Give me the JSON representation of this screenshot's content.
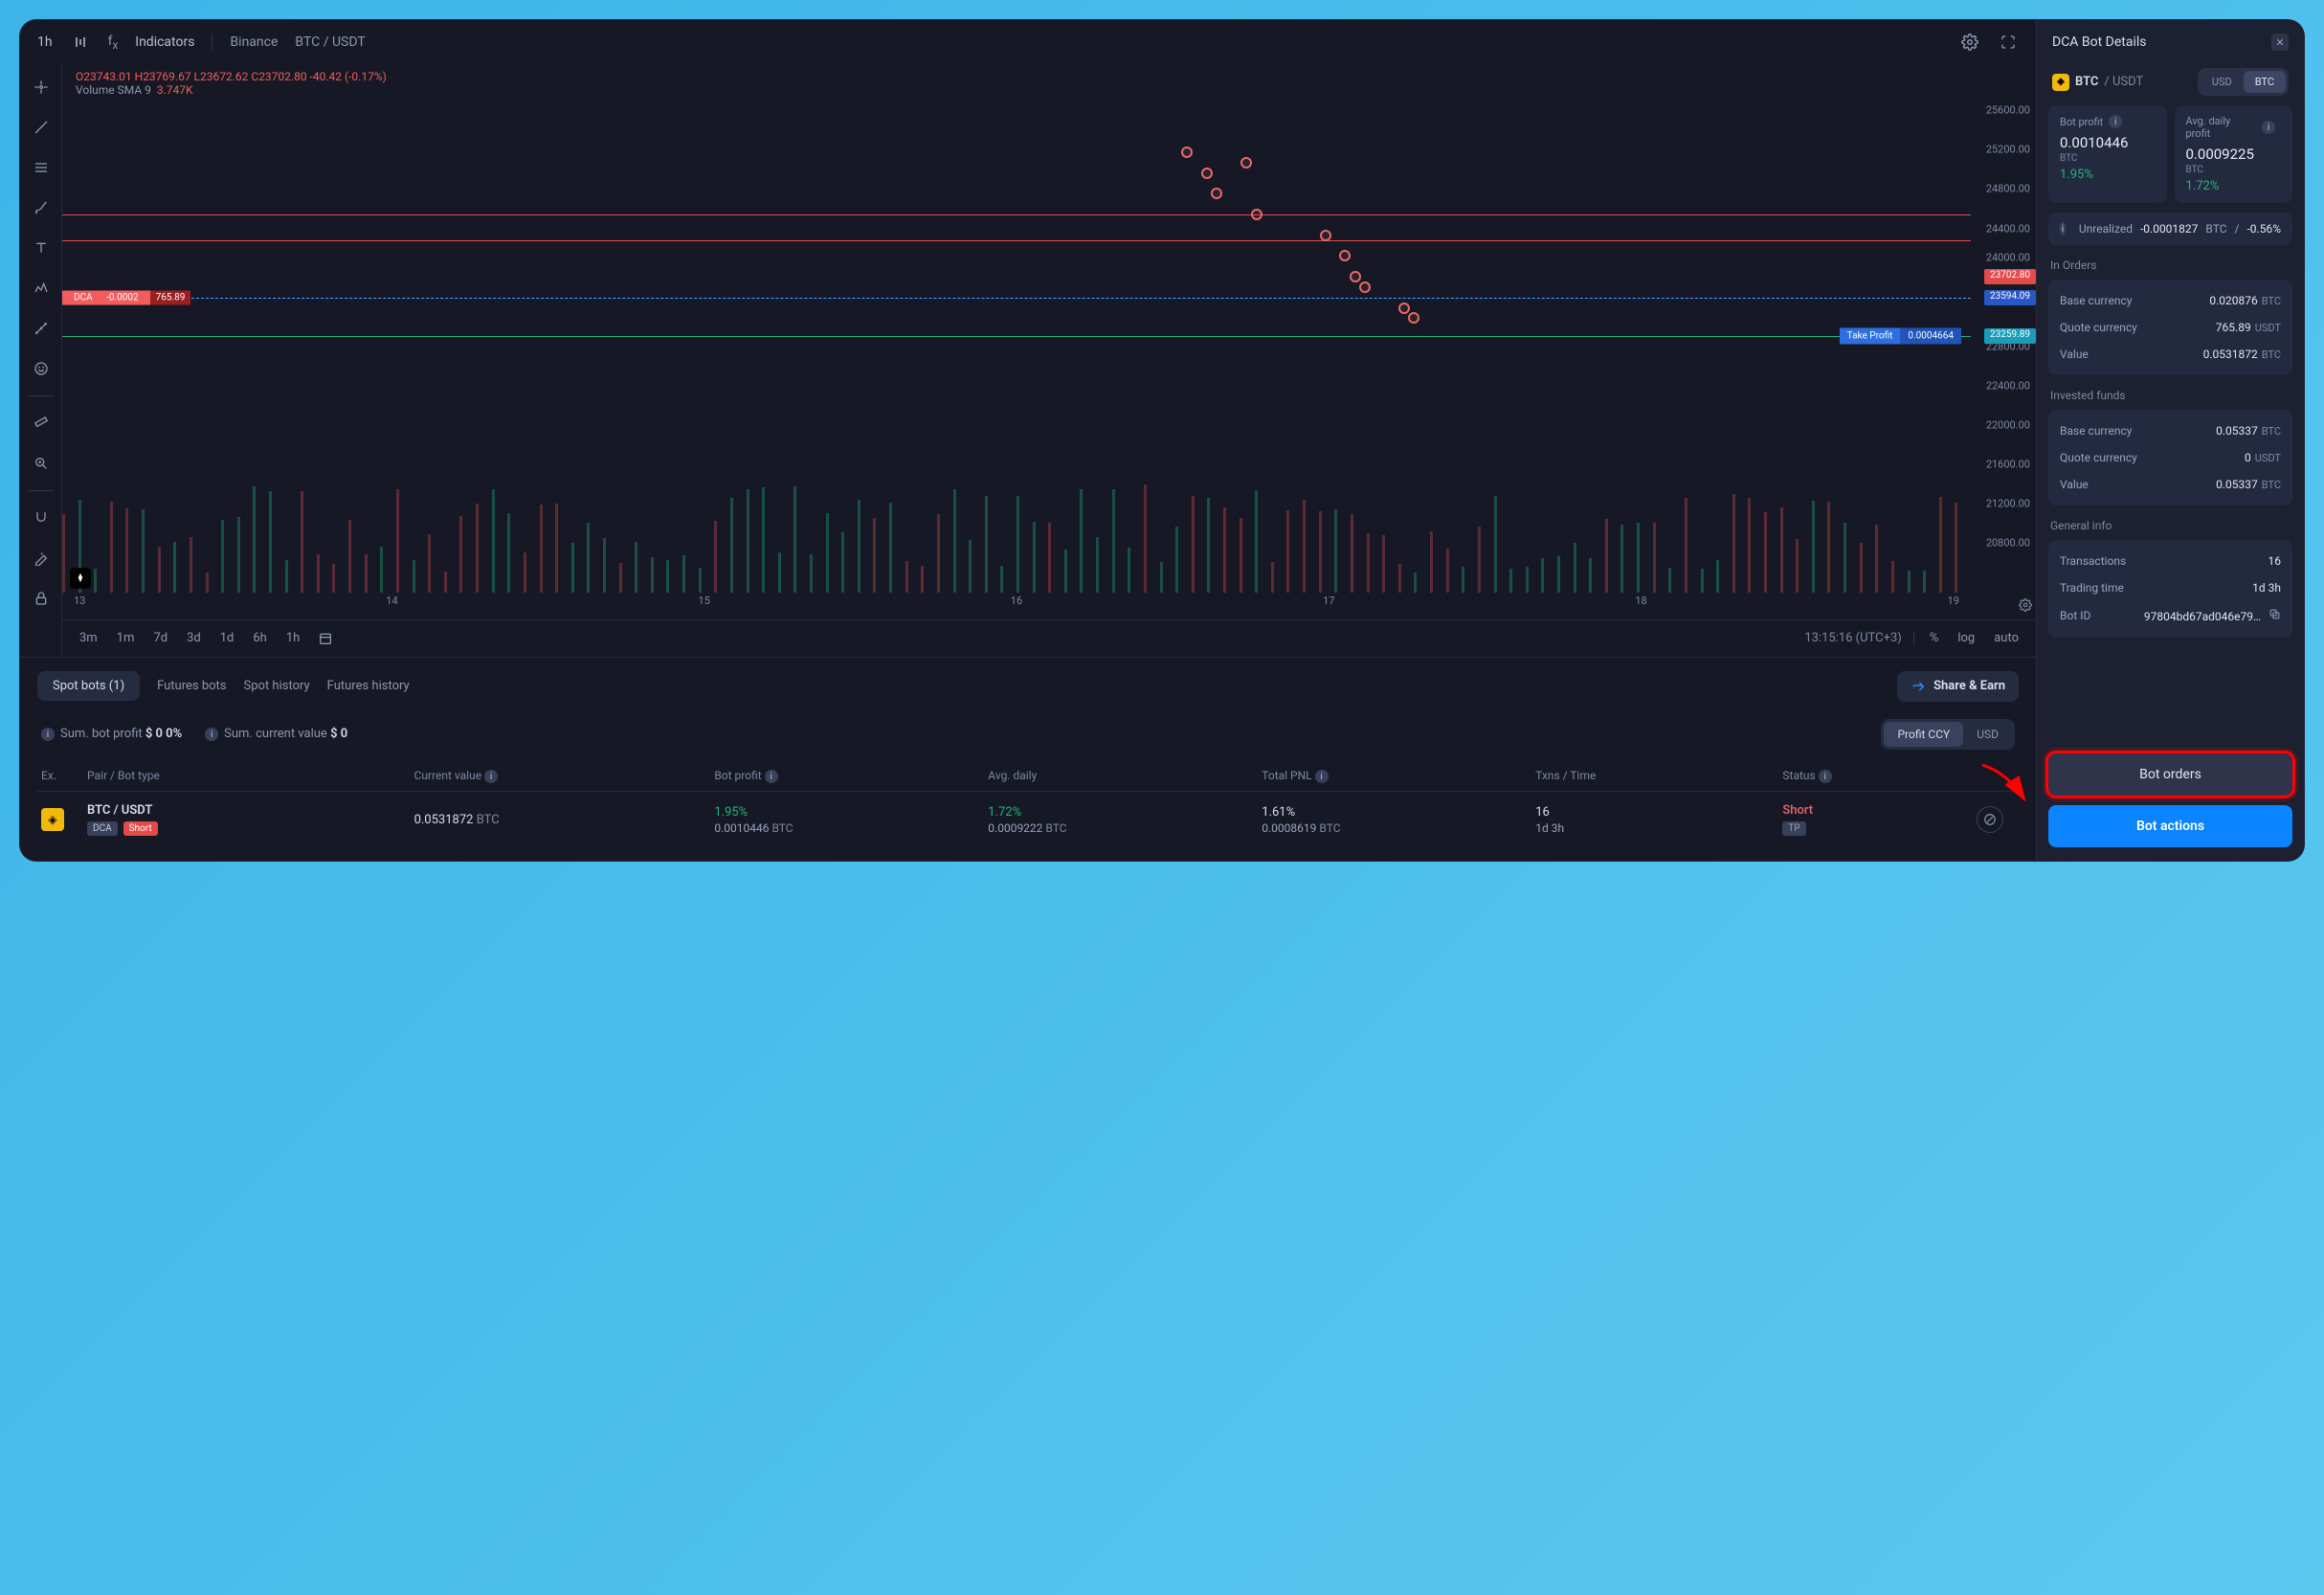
{
  "chart": {
    "timeframe": "1h",
    "indicators_label": "Indicators",
    "exchange": "Binance",
    "pair": "BTC / USDT",
    "ohlc": {
      "O": "23743.01",
      "H": "23769.67",
      "L": "23672.62",
      "C": "23702.80",
      "delta": "-40.42",
      "pct": "(-0.17%)"
    },
    "vol_sma_label": "Volume SMA 9",
    "vol_sma_value": "3.747K",
    "y_ticks": [
      "25600.00",
      "25200.00",
      "24800.00",
      "24400.00",
      "24000.00",
      "22800.00",
      "22400.00",
      "22000.00",
      "21600.00",
      "21200.00",
      "20800.00"
    ],
    "price_tags": {
      "red": "23702.80",
      "blue": "23594.09",
      "teal": "23259.89"
    },
    "dca_label": "DCA",
    "dca_val": "-0.0002",
    "dca_price": "765.89",
    "tp_label": "Take Profit",
    "tp_val": "0.0004664",
    "x_ticks": [
      "13",
      "14",
      "15",
      "16",
      "17",
      "18",
      "19"
    ],
    "bottom_tfs": [
      "3m",
      "1m",
      "7d",
      "3d",
      "1d",
      "6h",
      "1h"
    ],
    "clock": "13:15:16 (UTC+3)",
    "pct_label": "%",
    "log_label": "log",
    "auto_label": "auto"
  },
  "tabs": {
    "spot_bots": "Spot bots (1)",
    "futures_bots": "Futures bots",
    "spot_history": "Spot history",
    "futures_history": "Futures history",
    "share_earn": "Share & Earn"
  },
  "summary": {
    "bot_profit_label": "Sum. bot profit",
    "bot_profit_value": "$ 0  0%",
    "current_value_label": "Sum. current value",
    "current_value_value": "$ 0",
    "profit_ccy": "Profit CCY",
    "usd": "USD"
  },
  "columns": {
    "ex": "Ex.",
    "pair": "Pair / Bot type",
    "curval": "Current value",
    "botprofit": "Bot profit",
    "avgdaily": "Avg. daily",
    "totalpnl": "Total PNL",
    "txns": "Txns / Time",
    "status": "Status"
  },
  "row": {
    "pair": "BTC / USDT",
    "dca_badge": "DCA",
    "short_badge": "Short",
    "curval": "0.0531872",
    "curval_unit": "BTC",
    "botprofit_pct": "1.95%",
    "botprofit_val": "0.0010446",
    "botprofit_unit": "BTC",
    "avgdaily_pct": "1.72%",
    "avgdaily_val": "0.0009222",
    "avgdaily_unit": "BTC",
    "totalpnl_pct": "1.61%",
    "totalpnl_val": "0.0008619",
    "totalpnl_unit": "BTC",
    "txns": "16",
    "time": "1d 3h",
    "status": "Short",
    "status_sub": "TP"
  },
  "details": {
    "title": "DCA Bot Details",
    "pair_base": "BTC",
    "pair_sep": "/",
    "pair_quote": "USDT",
    "toggle_usd": "USD",
    "toggle_btc": "BTC",
    "bot_profit_label": "Bot profit",
    "bot_profit_val": "0.0010446",
    "bot_profit_unit": "BTC",
    "bot_profit_pct": "1.95%",
    "avg_daily_label": "Avg. daily profit",
    "avg_daily_val": "0.0009225",
    "avg_daily_unit": "BTC",
    "avg_daily_pct": "1.72%",
    "unrealized_label": "Unrealized",
    "unrealized_val": "-0.0001827",
    "unrealized_unit": "BTC",
    "unrealized_sep": "/",
    "unrealized_pct": "-0.56%",
    "in_orders_title": "In Orders",
    "io_base_label": "Base currency",
    "io_base_val": "0.020876",
    "io_base_unit": "BTC",
    "io_quote_label": "Quote currency",
    "io_quote_val": "765.89",
    "io_quote_unit": "USDT",
    "io_value_label": "Value",
    "io_value_val": "0.0531872",
    "io_value_unit": "BTC",
    "invested_title": "Invested funds",
    "if_base_label": "Base currency",
    "if_base_val": "0.05337",
    "if_base_unit": "BTC",
    "if_quote_label": "Quote currency",
    "if_quote_val": "0",
    "if_quote_unit": "USDT",
    "if_value_label": "Value",
    "if_value_val": "0.05337",
    "if_value_unit": "BTC",
    "general_title": "General info",
    "gi_txns_label": "Transactions",
    "gi_txns_val": "16",
    "gi_time_label": "Trading time",
    "gi_time_val": "1d 3h",
    "gi_botid_label": "Bot ID",
    "gi_botid_val": "97804bd67ad046e79…",
    "bot_orders_btn": "Bot orders",
    "bot_actions_btn": "Bot actions"
  }
}
